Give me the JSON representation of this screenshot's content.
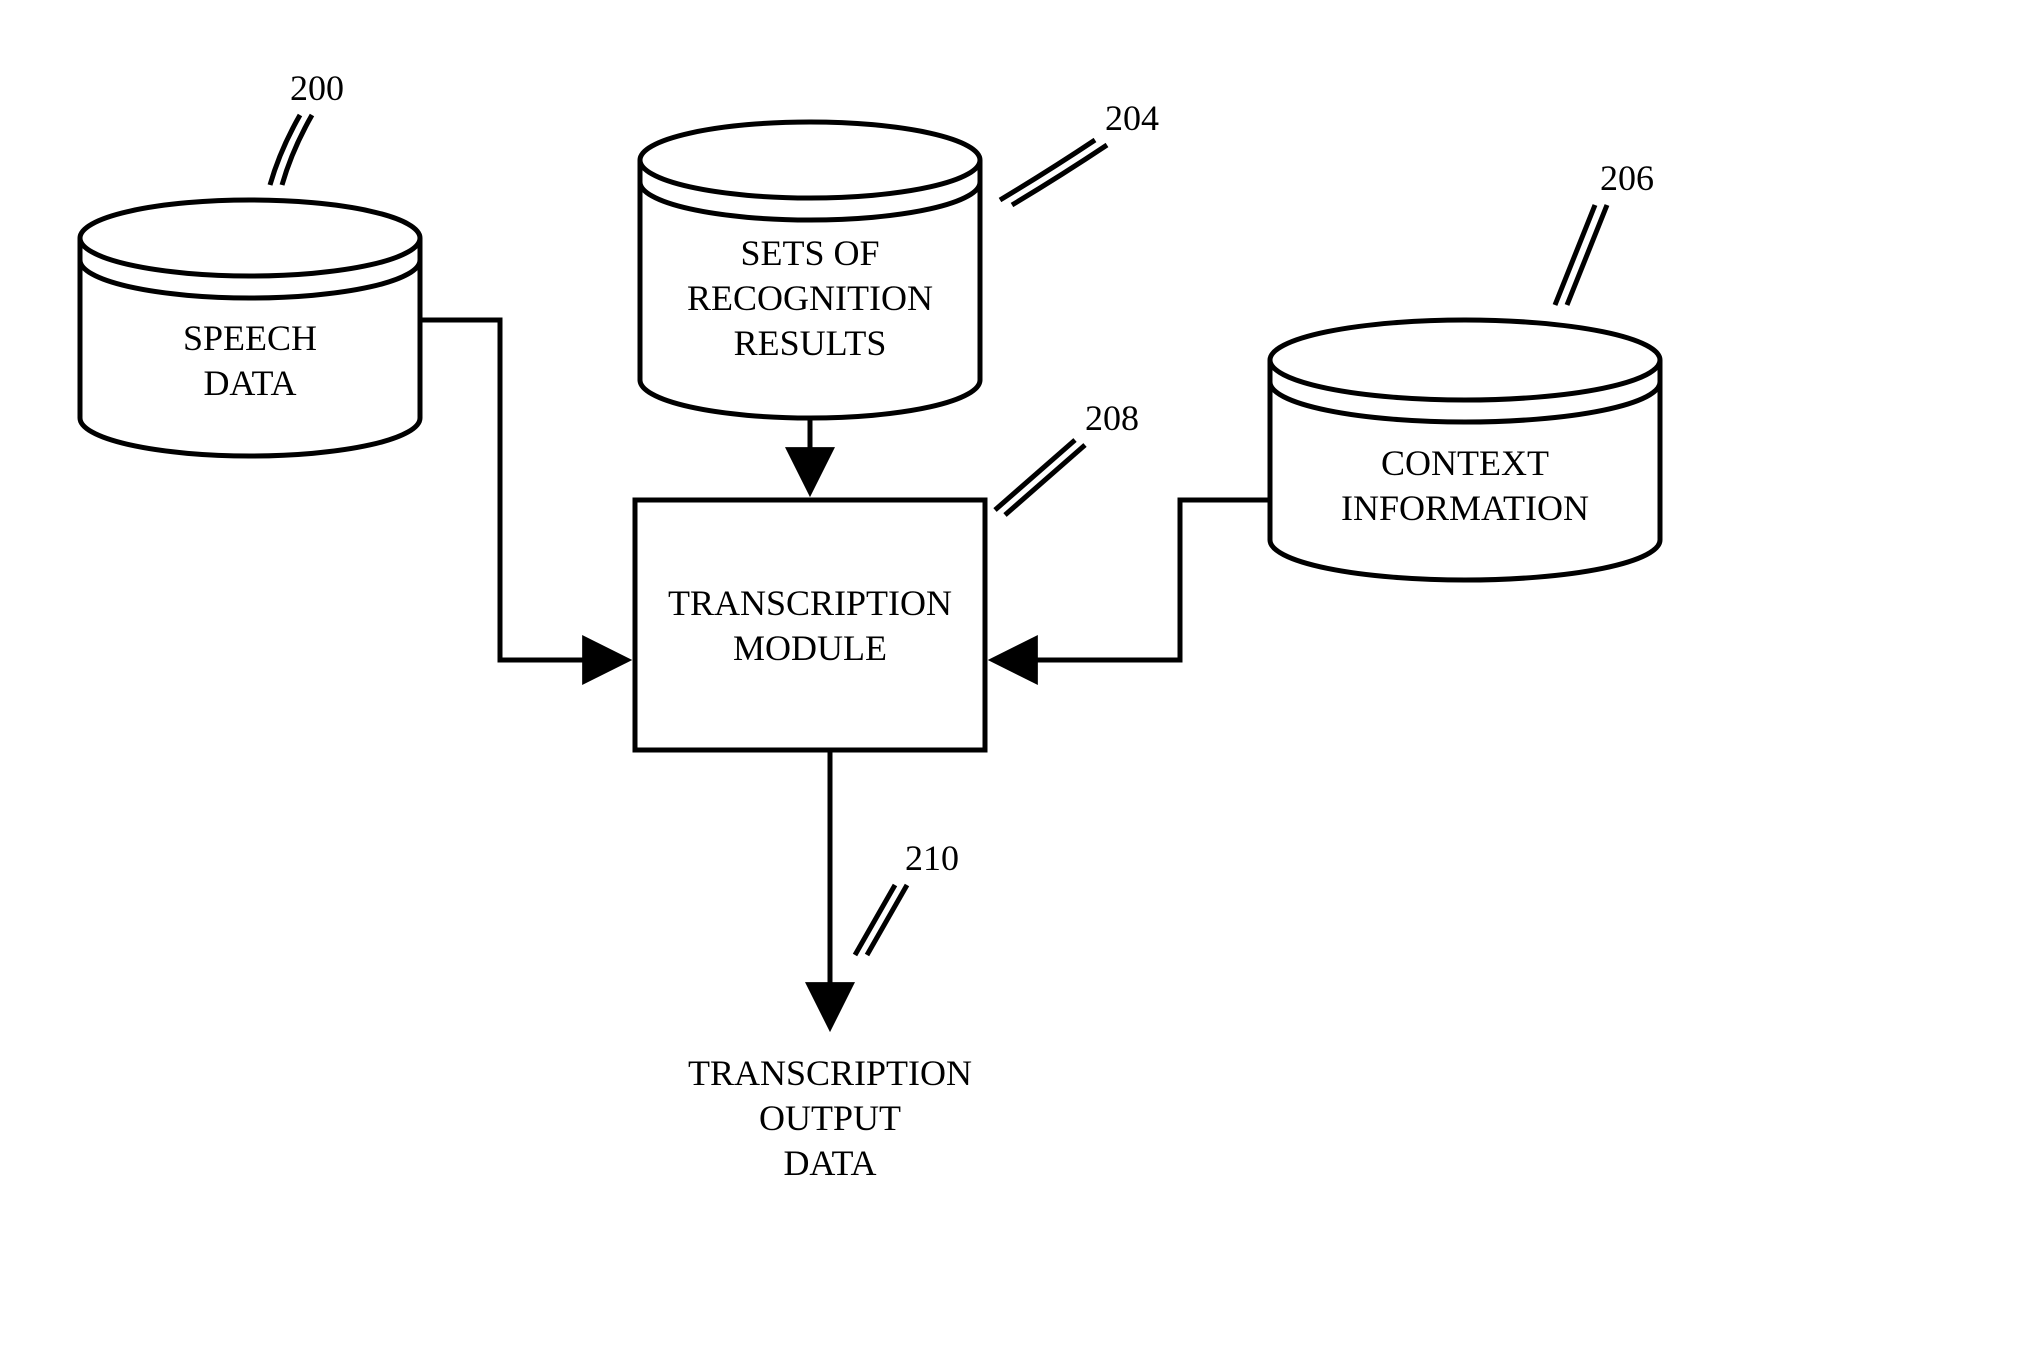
{
  "nodes": {
    "speech": {
      "ref": "200",
      "line1": "SPEECH",
      "line2": "DATA"
    },
    "recog": {
      "ref": "204",
      "line1": "SETS OF",
      "line2": "RECOGNITION",
      "line3": "RESULTS"
    },
    "context": {
      "ref": "206",
      "line1": "CONTEXT",
      "line2": "INFORMATION"
    },
    "module": {
      "ref": "208",
      "line1": "TRANSCRIPTION",
      "line2": "MODULE"
    },
    "output": {
      "ref": "210",
      "line1": "TRANSCRIPTION",
      "line2": "OUTPUT",
      "line3": "DATA"
    }
  }
}
